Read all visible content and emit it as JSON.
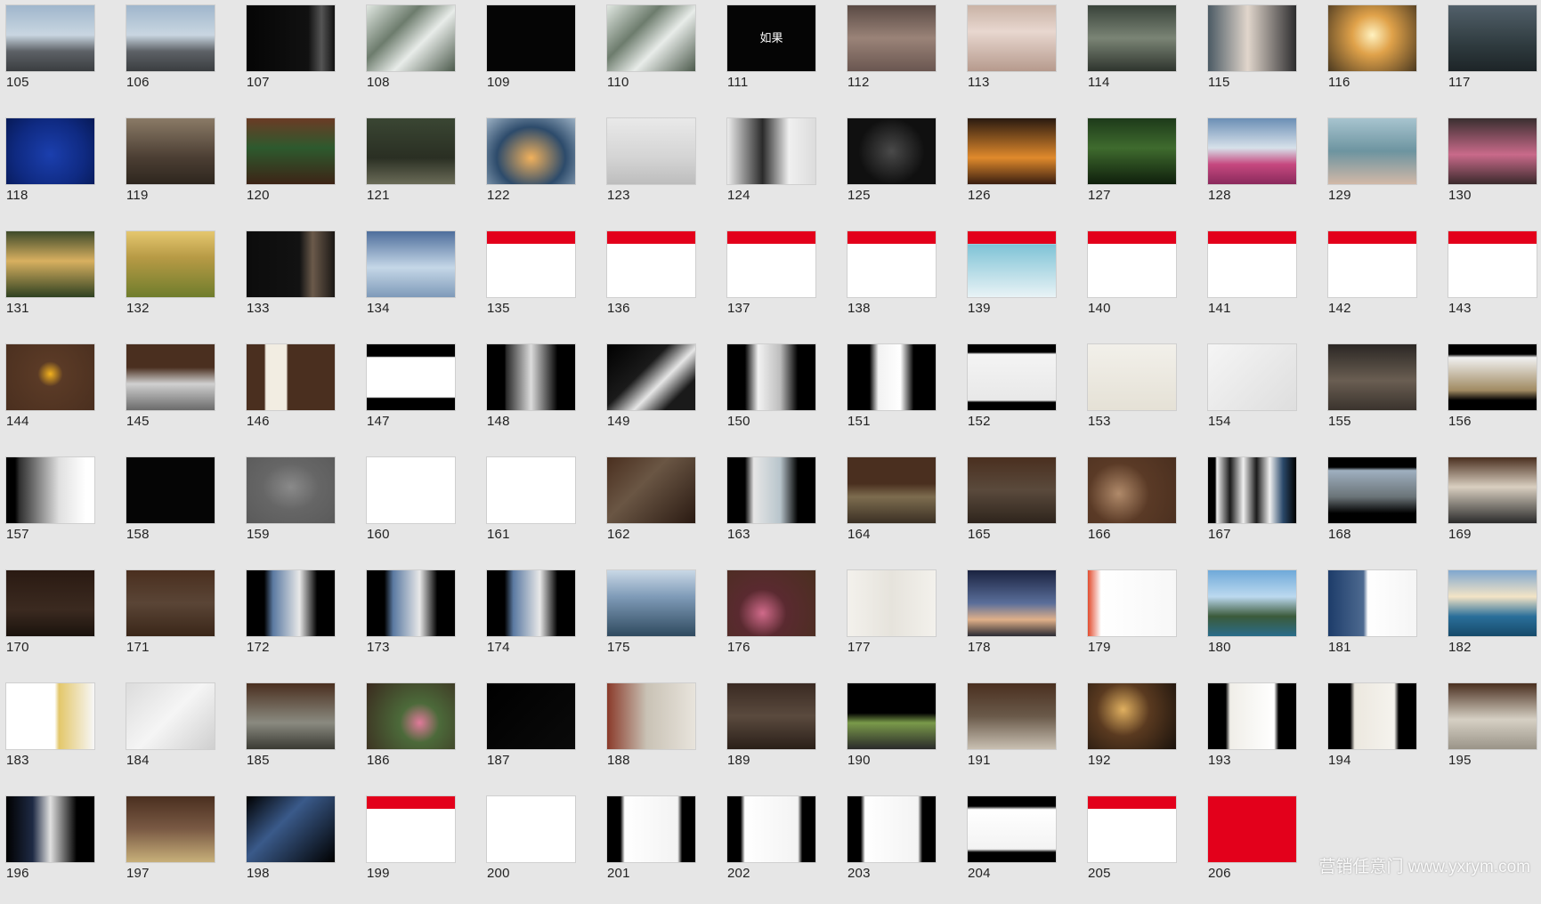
{
  "watermark": "营销任意门 www.yxrym.com",
  "slides": [
    {
      "n": "105",
      "bg": "linear-gradient(180deg,#9fb6cc 0%,#c9d6e1 45%,#5d6166 70%,#3a3d40 100%)"
    },
    {
      "n": "106",
      "bg": "linear-gradient(180deg,#9fb6cc 0%,#c9d6e1 45%,#5d6166 70%,#3a3d40 100%)"
    },
    {
      "n": "107",
      "bg": "linear-gradient(90deg,#050505 0%,#111 70%,#555 85%,#111 100%)"
    },
    {
      "n": "108",
      "bg": "linear-gradient(135deg,#dfe6e0 0%,#6d7c6d 35%,#e8ece9 60%,#4c5a4c 100%)"
    },
    {
      "n": "109",
      "bg": "#050505"
    },
    {
      "n": "110",
      "bg": "linear-gradient(135deg,#dfe6e0 0%,#6d7c6d 35%,#e8ece9 60%,#4c5a4c 100%)"
    },
    {
      "n": "111",
      "bg": "#050505",
      "text": "如果"
    },
    {
      "n": "112",
      "bg": "linear-gradient(180deg,#5a4a44 0%,#9a8378 50%,#6a5650 100%)"
    },
    {
      "n": "113",
      "bg": "linear-gradient(180deg,#c9b3a6 0%,#e8d7cf 40%,#b69a8d 100%)"
    },
    {
      "n": "114",
      "bg": "linear-gradient(180deg,#39433a 0%,#7a8475 50%,#2e342d 100%)"
    },
    {
      "n": "115",
      "bg": "linear-gradient(90deg,#4b5a64 0%,#e1d6cc 45%,#2c2c2e 100%)"
    },
    {
      "n": "116",
      "bg": "radial-gradient(circle at 50% 45%,#fff2c0 0%,#e0a24a 35%,#4b3920 100%)"
    },
    {
      "n": "117",
      "bg": "linear-gradient(180deg,#52606a 0%,#2f3b3f 60%,#1d2427 100%)"
    },
    {
      "n": "118",
      "bg": "radial-gradient(circle at 50% 55%,#1b3fae 0%,#0f2a82 60%,#071a57 100%)"
    },
    {
      "n": "119",
      "bg": "linear-gradient(180deg,#8a7a66 0%,#4b3e33 60%,#2e261e 100%)"
    },
    {
      "n": "120",
      "bg": "linear-gradient(180deg,#6b3b25 0%,#2d5a2e 45%,#3d2416 100%)"
    },
    {
      "n": "121",
      "bg": "linear-gradient(180deg,#3a4633 0%,#2a2f23 60%,#6b6c58 100%)"
    },
    {
      "n": "122",
      "bg": "radial-gradient(ellipse at 50% 60%,#f1b15c 0%,#2d4b6b 55%,#9bb0c3 100%)"
    },
    {
      "n": "123",
      "bg": "linear-gradient(180deg,#e9e9e9 0%,#d4d4d4 60%,#bdbdbd 100%)"
    },
    {
      "n": "124",
      "bg": "linear-gradient(90deg,#ececec 0%,#2a2a2a 40%,#f0f0f0 70%,#dcdcdc 100%)"
    },
    {
      "n": "125",
      "bg": "radial-gradient(circle at 50% 50%,#4a4a4a 0%,#101010 60%)"
    },
    {
      "n": "126",
      "bg": "linear-gradient(180deg,#2a1a10 0%,#e08a2c 60%,#3a1e10 100%)"
    },
    {
      "n": "127",
      "bg": "linear-gradient(180deg,#1d3a1a 0%,#3f6b2e 45%,#0f1f0c 100%)"
    },
    {
      "n": "128",
      "bg": "linear-gradient(180deg,#6b8fb5 0%,#d7e1ea 45%,#c6487f 70%,#8a2a5c 100%)"
    },
    {
      "n": "129",
      "bg": "linear-gradient(180deg,#a7c4cf 0%,#6d94a0 50%,#d2b8a7 100%)"
    },
    {
      "n": "130",
      "bg": "linear-gradient(180deg,#3a2f30 0%,#c96a8a 55%,#3b2a2c 100%)"
    },
    {
      "n": "131",
      "bg": "linear-gradient(180deg,#3d4a2a 0%,#d8b060 45%,#2f4121 100%)"
    },
    {
      "n": "132",
      "bg": "linear-gradient(180deg,#e5c76f 0%,#b79a45 40%,#6f7d2c 100%)"
    },
    {
      "n": "133",
      "bg": "linear-gradient(90deg,#0c0c0c 0%,#121212 60%,#6b5a4b 75%,#1a1714 100%)"
    },
    {
      "n": "134",
      "bg": "linear-gradient(180deg,#4e6e9c 0%,#c5d7e7 55%,#7e9ab9 100%)"
    },
    {
      "n": "135",
      "bg": "#ffffff",
      "band": "#e3001b",
      "bandTop": 0,
      "bandH": 14
    },
    {
      "n": "136",
      "bg": "#ffffff",
      "band": "#e3001b",
      "bandTop": 0,
      "bandH": 14
    },
    {
      "n": "137",
      "bg": "#ffffff",
      "band": "#e3001b",
      "bandTop": 0,
      "bandH": 14
    },
    {
      "n": "138",
      "bg": "#ffffff",
      "band": "#e3001b",
      "bandTop": 0,
      "bandH": 14
    },
    {
      "n": "139",
      "bg": "linear-gradient(180deg,#ffffff 0%,#ffffff 18%,#7fc3d6 20%,#e9f3f6 100%)",
      "band": "#e3001b",
      "bandTop": 0,
      "bandH": 14
    },
    {
      "n": "140",
      "bg": "#ffffff",
      "band": "#e3001b",
      "bandTop": 0,
      "bandH": 14
    },
    {
      "n": "141",
      "bg": "#ffffff",
      "band": "#e3001b",
      "bandTop": 0,
      "bandH": 14
    },
    {
      "n": "142",
      "bg": "#ffffff",
      "band": "#e3001b",
      "bandTop": 0,
      "bandH": 14
    },
    {
      "n": "143",
      "bg": "#ffffff",
      "band": "#e3001b",
      "bandTop": 0,
      "bandH": 14
    },
    {
      "n": "144",
      "bg": "radial-gradient(circle at 50% 45%,#f3b21e 0%,#5a3a26 22%,#4a2f1f 100%)"
    },
    {
      "n": "145",
      "bg": "linear-gradient(180deg,#4a2f1f 0%,#4a2f1f 35%,#d0d0d0 60%,#6a6a6a 100%)"
    },
    {
      "n": "146",
      "bg": "linear-gradient(90deg,#4a2f1f 0%,#4a2f1f 20%,#f2ede2 22%,#f2ede2 45%,#4a2f1f 47%)"
    },
    {
      "n": "147",
      "bg": "linear-gradient(180deg,#000 0%,#000 18%,#ffffff 20%,#ffffff 80%,#000 82%)"
    },
    {
      "n": "148",
      "bg": "linear-gradient(90deg,#000 0%,#000 20%,#2a2a2a 22%,#dcdcdc 50%,#111 78%,#000 80%)"
    },
    {
      "n": "149",
      "bg": "linear-gradient(135deg,#000 0%,#1a1a1a 40%,#e6e6e6 60%,#1a1a1a 80%)"
    },
    {
      "n": "150",
      "bg": "linear-gradient(90deg,#000 0%,#000 20%,#f2f2f2 35%,#bdbdbd 60%,#000 80%)"
    },
    {
      "n": "151",
      "bg": "linear-gradient(90deg,#000 0%,#000 25%,#f2f2f2 35%,#ffffff 60%,#000 75%)"
    },
    {
      "n": "152",
      "bg": "linear-gradient(180deg,#000 0%,#000 12%,#f4f4f4 15%,#e8e8e8 85%,#000 88%)"
    },
    {
      "n": "153",
      "bg": "linear-gradient(180deg,#f2f0ea 0%,#e5e1d6 100%)"
    },
    {
      "n": "154",
      "bg": "linear-gradient(135deg,#f5f5f5 0%,#dedede 100%)"
    },
    {
      "n": "155",
      "bg": "linear-gradient(180deg,#2b2724 0%,#6a5e52 55%,#3a332d 100%)"
    },
    {
      "n": "156",
      "bg": "linear-gradient(180deg,#000 0%,#000 15%,#f0f0f0 20%,#a08a62 70%,#000 85%)"
    },
    {
      "n": "157",
      "bg": "linear-gradient(90deg,#000 0%,#000 10%,#2f2f2f 15%,#e0e0e0 60%,#ffffff 90%)"
    },
    {
      "n": "158",
      "bg": "#050505"
    },
    {
      "n": "159",
      "bg": "radial-gradient(ellipse at 50% 45%,#8a8a8a 0%,#666 45%,#5a5a5a 100%)"
    },
    {
      "n": "160",
      "bg": "#ffffff"
    },
    {
      "n": "161",
      "bg": "#ffffff"
    },
    {
      "n": "162",
      "bg": "linear-gradient(135deg,#4a2f1f 0%,#6a5644 40%,#2a1a12 100%)"
    },
    {
      "n": "163",
      "bg": "linear-gradient(90deg,#000 0%,#000 20%,#e6e6e6 30%,#b8c5cc 60%,#000 80%)"
    },
    {
      "n": "164",
      "bg": "linear-gradient(180deg,#4a2f1f 0%,#4a2f1f 40%,#7d6c4f 60%,#3b3024 100%)"
    },
    {
      "n": "165",
      "bg": "linear-gradient(180deg,#4a2f1f 0%,#5a4a3c 50%,#2e241c 100%)"
    },
    {
      "n": "166",
      "bg": "radial-gradient(circle at 35% 55%,#b08a6a 0%,#5a3a26 45%,#4a2f1f 100%)"
    },
    {
      "n": "167",
      "bg": "linear-gradient(90deg,#000 0%,#000 8%,#f0f0f0 10%,#1a1a1a 25%,#f0f0f0 40%,#1a1a1a 55%,#f0f0f0 70%,#2b4a6b 85%,#000 100%)"
    },
    {
      "n": "168",
      "bg": "linear-gradient(180deg,#000 0%,#000 15%,#9fb0c0 20%,#6b7478 60%,#000 85%)"
    },
    {
      "n": "169",
      "bg": "linear-gradient(180deg,#4a2f1f 0%,#d9cfc0 45%,#2b2b2b 100%)"
    },
    {
      "n": "170",
      "bg": "linear-gradient(180deg,#2a1a12 0%,#3b2a20 60%,#1a120c 100%)"
    },
    {
      "n": "171",
      "bg": "linear-gradient(180deg,#4a2f1f 0%,#5a4536 50%,#3a2618 100%)"
    },
    {
      "n": "172",
      "bg": "linear-gradient(90deg,#000 0%,#000 20%,#5b7aa2 30%,#e8e8e8 60%,#000 80%)"
    },
    {
      "n": "173",
      "bg": "linear-gradient(90deg,#000 0%,#000 20%,#5b7aa2 30%,#e8e8e8 60%,#000 80%)"
    },
    {
      "n": "174",
      "bg": "linear-gradient(90deg,#000 0%,#000 20%,#5b7aa2 30%,#e8e8e8 60%,#000 80%)"
    },
    {
      "n": "175",
      "bg": "linear-gradient(180deg,#c9d8e6 0%,#7f9bb8 40%,#2f4a5f 100%)"
    },
    {
      "n": "176",
      "bg": "radial-gradient(circle at 40% 65%,#d06a8a 0%,#5a2a30 35%,#4a2f1f 100%)"
    },
    {
      "n": "177",
      "bg": "linear-gradient(90deg,#f3f1ec 0%,#e6e3dc 50%,#f3f1ec 100%)"
    },
    {
      "n": "178",
      "bg": "linear-gradient(180deg,#1a2340 0%,#5a6e9a 50%,#e0b089 75%,#2a2a33 100%)"
    },
    {
      "n": "179",
      "bg": "linear-gradient(90deg,#e24c2e 0%,#ffffff 15%,#f7f7f7 100%)"
    },
    {
      "n": "180",
      "bg": "linear-gradient(180deg,#6fa9d9 0%,#bcd9ef 40%,#3b5a3a 70%,#2a6c8a 100%)"
    },
    {
      "n": "181",
      "bg": "linear-gradient(90deg,#1d3c6a 0%,#4d6a90 40%,#ffffff 45%,#f5f5f5 100%)"
    },
    {
      "n": "182",
      "bg": "linear-gradient(180deg,#7fa7cf 0%,#f3e4c6 40%,#2a6f9a 70%,#164a6a 100%)"
    },
    {
      "n": "183",
      "bg": "linear-gradient(90deg,#ffffff 0%,#ffffff 55%,#e3c76a 60%,#f7f7f7 100%)"
    },
    {
      "n": "184",
      "bg": "linear-gradient(135deg,#dcdcdc 0%,#f5f5f5 50%,#cfcfcf 100%)"
    },
    {
      "n": "185",
      "bg": "linear-gradient(180deg,#4a2f1f 0%,#8a8a80 60%,#3a3a33 100%)"
    },
    {
      "n": "186",
      "bg": "radial-gradient(circle at 60% 60%,#e07a9a 0%,#4c6a3a 30%,#3a2a1e 100%)"
    },
    {
      "n": "187",
      "bg": "linear-gradient(135deg,#000 0%,#0a0a0a 100%)"
    },
    {
      "n": "188",
      "bg": "linear-gradient(90deg,#8a3a2a 0%,#c9c2b5 45%,#e8e4dc 100%)"
    },
    {
      "n": "189",
      "bg": "linear-gradient(180deg,#3a2a22 0%,#5a4a3e 50%,#2a1f18 100%)"
    },
    {
      "n": "190",
      "bg": "linear-gradient(180deg,#000 0%,#000 45%,#7a9a4a 60%,#2a2a2a 100%)"
    },
    {
      "n": "191",
      "bg": "linear-gradient(180deg,#4a2f1f 0%,#6a5a4a 50%,#c9c0b2 100%)"
    },
    {
      "n": "192",
      "bg": "radial-gradient(circle at 40% 40%,#e0b060 0%,#5a3a20 40%,#1a120c 100%)"
    },
    {
      "n": "193",
      "bg": "linear-gradient(90deg,#000 0%,#000 20%,#f0eee8 25%,#ffffff 75%,#000 80%)"
    },
    {
      "n": "194",
      "bg": "linear-gradient(90deg,#000 0%,#000 25%,#ece8df 30%,#f5f3ee 75%,#000 80%)"
    },
    {
      "n": "195",
      "bg": "linear-gradient(180deg,#4a2f1f 0%,#d6d0c4 55%,#9a9488 100%)"
    },
    {
      "n": "196",
      "bg": "linear-gradient(90deg,#000 0%,#1e2a44 30%,#e0e0e0 50%,#000 80%)"
    },
    {
      "n": "197",
      "bg": "linear-gradient(180deg,#4a2f1f 0%,#7a5a44 50%,#c8b07a 100%)"
    },
    {
      "n": "198",
      "bg": "linear-gradient(135deg,#000 0%,#3a5a8a 40%,#000 100%)"
    },
    {
      "n": "199",
      "bg": "#ffffff",
      "band": "#e3001b",
      "bandTop": 0,
      "bandH": 14
    },
    {
      "n": "200",
      "bg": "#ffffff"
    },
    {
      "n": "201",
      "bg": "linear-gradient(90deg,#000 0%,#000 15%,#ffffff 20%,#f3f3f3 80%,#000 85%)"
    },
    {
      "n": "202",
      "bg": "linear-gradient(90deg,#000 0%,#000 15%,#ffffff 20%,#f3f3f3 80%,#000 85%)"
    },
    {
      "n": "203",
      "bg": "linear-gradient(90deg,#000 0%,#000 15%,#ffffff 20%,#f3f3f3 80%,#000 85%)"
    },
    {
      "n": "204",
      "bg": "linear-gradient(180deg,#000 0%,#000 15%,#ffffff 20%,#f3f3f3 80%,#000 85%)"
    },
    {
      "n": "205",
      "bg": "#ffffff",
      "band": "#e3001b",
      "bandTop": 0,
      "bandH": 14
    },
    {
      "n": "206",
      "bg": "#e3001b"
    }
  ]
}
